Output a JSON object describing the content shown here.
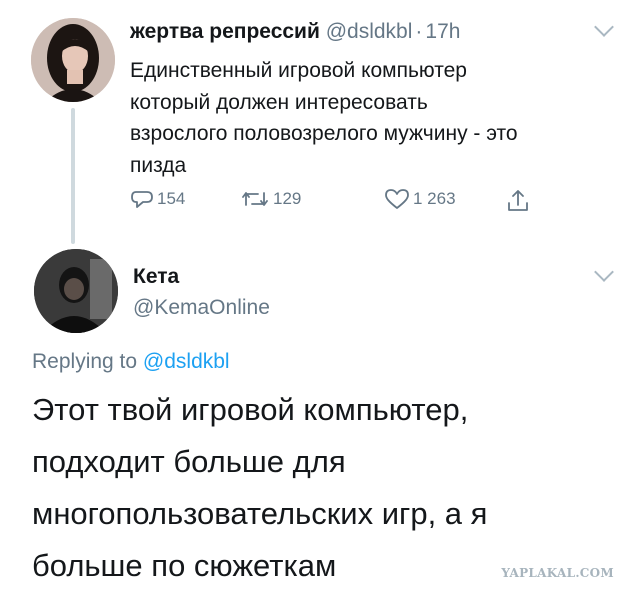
{
  "tweet1": {
    "name": "жертва репрессий",
    "handle": "@dsldkbl",
    "separator": "·",
    "time": "17h",
    "text_lines": [
      "Единственный игровой компьютер",
      "который должен интересовать",
      "взрослого половозрелого мужчину - это",
      "пизда"
    ],
    "actions": {
      "replies": "154",
      "retweets": "129",
      "likes": "1 263"
    }
  },
  "tweet2": {
    "name": "Кета",
    "handle": "@KemaOnline",
    "replying_prefix": "Replying to",
    "replying_mention": "@dsldkbl",
    "text_lines": [
      "Этот твой игровой компьютер,",
      "подходит больше для",
      "многопользовательских игр, а я",
      "больше по сюжеткам"
    ]
  },
  "watermark": "YAPLAKAL.COM",
  "colors": {
    "text": "#14171a",
    "muted": "#657786",
    "link": "#1da1f2",
    "thread_line": "#cfd9de"
  }
}
